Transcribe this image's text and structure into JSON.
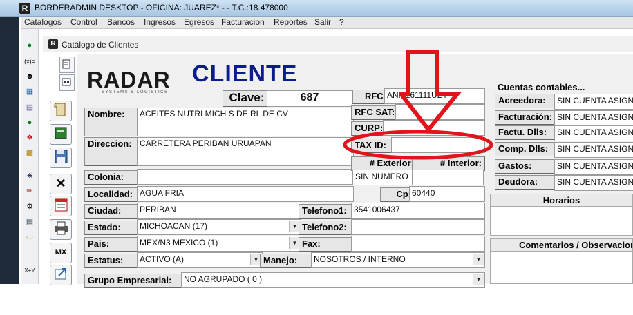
{
  "window": {
    "title": "BORDERADMIN DESKTOP - OFICINA: JUAREZ* -  - T.C.:18.478000",
    "logo_letter": "R"
  },
  "menu": [
    "Catalogos",
    "Control",
    "Bancos",
    "Ingresos",
    "Egresos",
    "Facturacion",
    "Reportes",
    "Salir",
    "?"
  ],
  "desktop_toolbar_icons": [
    "money-bag-icon",
    "formula-icon",
    "user-hat-icon",
    "calculator-icon",
    "document-icon",
    "money-bag-icon",
    "pill-icon",
    "chart-icon",
    "network-icon",
    "pencil-icon",
    "gear-icon",
    "book-icon",
    "bus-icon",
    "formula-icon"
  ],
  "desktop_toolbar_texts": {
    "formula": "(x)=",
    "formula2": "X+Y"
  },
  "inner_window": {
    "title": "Catálogo de Clientes",
    "logo_letter": "R"
  },
  "side_buttons": {
    "mx_label": "MX"
  },
  "header": {
    "brand": "RADAR",
    "brand_tagline": "SYSTEMS & LOGISTICS",
    "title": "CLIENTE",
    "clave_label": "Clave:",
    "clave_value": "687"
  },
  "form": {
    "nombre_label": "Nombre:",
    "nombre_value": "ACEITES NUTRI MICH S DE RL DE CV",
    "direccion_label": "Direccion:",
    "direccion_value": "CARRETERA PERIBAN URUAPAN",
    "colonia_label": "Colonia:",
    "colonia_value": "",
    "localidad_label": "Localidad:",
    "localidad_value": "AGUA FRIA",
    "ciudad_label": "Ciudad:",
    "ciudad_value": "PERIBAN",
    "estado_label": "Estado:",
    "estado_value": "MICHOACAN (17)",
    "pais_label": "Pais:",
    "pais_value": "MEX/N3 MEXICO (1)",
    "estatus_label": "Estatus:",
    "estatus_value": "ACTIVO (A)",
    "manejo_label": "Manejo:",
    "manejo_value": "NOSOTROS / INTERNO",
    "grupo_label": "Grupo Empresarial:",
    "grupo_value": "NO AGRUPADO ( 0 )",
    "rfc_label": "RFC:",
    "rfc_value": "ANM161111U24",
    "rfc_sat_label": "RFC SAT:",
    "rfc_sat_value": "",
    "curp_label": "CURP:",
    "curp_value": "",
    "taxid_label": "TAX ID:",
    "taxid_value": "",
    "exterior_label": "# Exterior:",
    "interior_label": "# Interior:",
    "exterior_value": "SIN NUMERO",
    "interior_value": "",
    "cp_label": "Cp:",
    "cp_value": "60440",
    "telefono1_label": "Telefono1:",
    "telefono1_value": "3541006437",
    "telefono2_label": "Telefono2:",
    "telefono2_value": "",
    "fax_label": "Fax:",
    "fax_value": ""
  },
  "cuentas": {
    "header": "Cuentas contables...",
    "rows": [
      {
        "label": "Acreedora:",
        "value": "SIN CUENTA ASIGNADA"
      },
      {
        "label": "Facturación:",
        "value": "SIN CUENTA ASIGNADA"
      },
      {
        "label": "Factu. Dlls:",
        "value": "SIN CUENTA ASIGNADA"
      },
      {
        "label": "Comp. Dlls:",
        "value": "SIN CUENTA ASIGNADA"
      },
      {
        "label": "Gastos:",
        "value": "SIN CUENTA ASIGNADA"
      },
      {
        "label": "Deudora:",
        "value": "SIN CUENTA ASIGNADA"
      }
    ]
  },
  "horarios_header": "Horarios",
  "comentarios_header": "Comentarios / Observaciones",
  "annotation_color": "#e3131b"
}
